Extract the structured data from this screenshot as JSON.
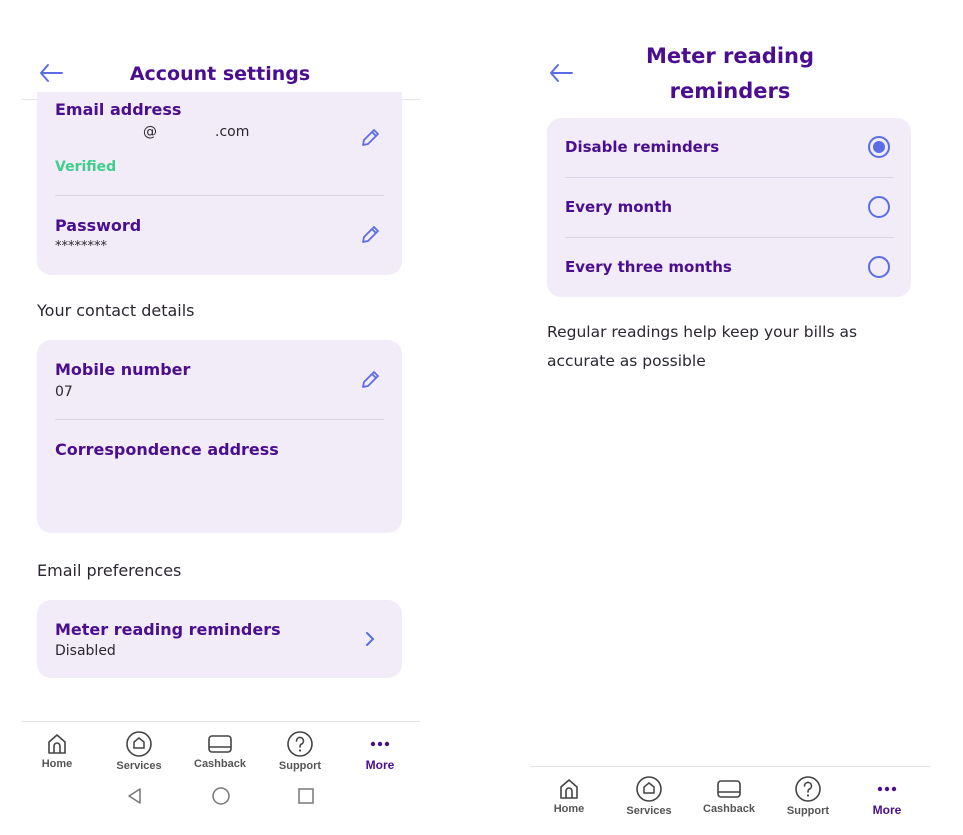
{
  "left": {
    "header": {
      "title": "Account settings"
    },
    "account": {
      "email_label": "Email address",
      "email_at": "@",
      "email_domain": ".com",
      "email_status": "Verified",
      "password_label": "Password",
      "password_value": "********"
    },
    "contact": {
      "section_title": "Your contact details",
      "mobile_label": "Mobile number",
      "mobile_value": "07",
      "address_label": "Correspondence address"
    },
    "email_prefs": {
      "section_title": "Email preferences",
      "meter_label": "Meter reading reminders",
      "meter_value": "Disabled"
    },
    "nav": {
      "items": [
        {
          "label": "Home",
          "icon": "home-icon"
        },
        {
          "label": "Services",
          "icon": "services-icon"
        },
        {
          "label": "Cashback",
          "icon": "cashback-icon"
        },
        {
          "label": "Support",
          "icon": "support-icon"
        },
        {
          "label": "More",
          "icon": "more-icon",
          "active": true
        }
      ]
    }
  },
  "right": {
    "header": {
      "title_line1": "Meter reading",
      "title_line2": "reminders"
    },
    "options": [
      {
        "label": "Disable reminders",
        "selected": true
      },
      {
        "label": "Every month",
        "selected": false
      },
      {
        "label": "Every three months",
        "selected": false
      }
    ],
    "note": "Regular readings help keep your bills as accurate as possible",
    "nav": {
      "items": [
        {
          "label": "Home",
          "icon": "home-icon"
        },
        {
          "label": "Services",
          "icon": "services-icon"
        },
        {
          "label": "Cashback",
          "icon": "cashback-icon"
        },
        {
          "label": "Support",
          "icon": "support-icon"
        },
        {
          "label": "More",
          "icon": "more-icon",
          "active": true
        }
      ]
    }
  },
  "colors": {
    "brand": "#4a0e8f",
    "accent": "#5b6ee8",
    "card_bg": "#f1ecf7",
    "verified": "#3fcf8a"
  }
}
